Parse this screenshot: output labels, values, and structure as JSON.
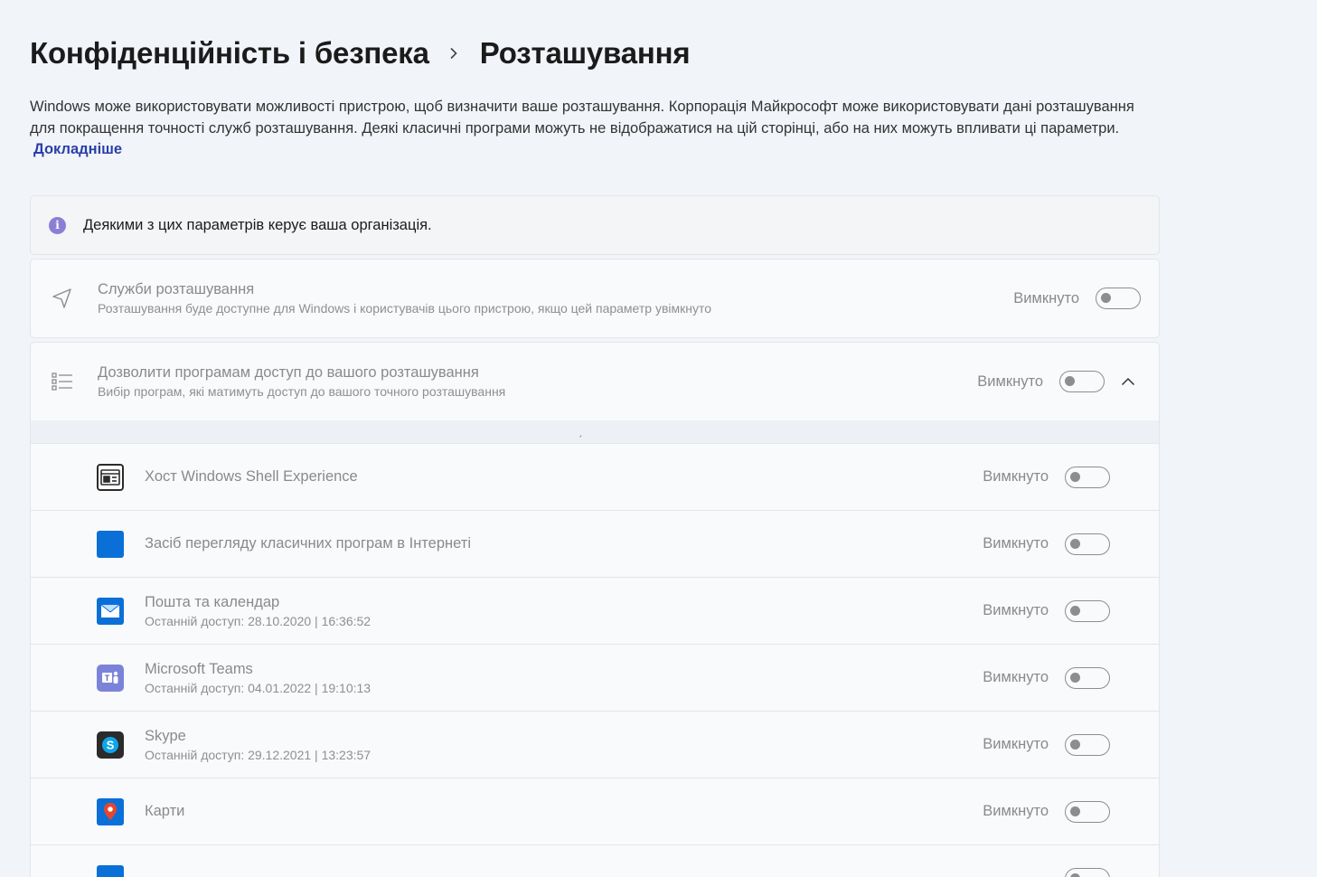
{
  "breadcrumb": {
    "parent": "Конфіденційність і безпека",
    "current": "Розташування"
  },
  "description": {
    "text": "Windows може використовувати можливості пристрою, щоб визначити ваше розташування. Корпорація Майкрософт може використовувати дані розташування для покращення точності служб розташування. Деякі класичні програми можуть не відображатися на цій сторінці, або на них можуть впливати ці параметри.",
    "link": "Докладніше"
  },
  "info_bar": {
    "icon": "info-icon",
    "text": "Деякими з цих параметрів керує ваша організація."
  },
  "location_services": {
    "icon": "location-arrow-icon",
    "title": "Служби розташування",
    "subtitle": "Розташування буде доступне для Windows і користувачів цього пристрою, якщо цей параметр увімкнуто",
    "state": "Вимкнуто"
  },
  "app_access": {
    "icon": "list-icon",
    "title": "Дозволити програмам доступ до вашого розташування",
    "subtitle": "Вибір програм, які матимуть доступ до вашого точного розташування",
    "state": "Вимкнуто"
  },
  "apps": [
    {
      "name": "Хост Windows Shell Experience",
      "sub": "",
      "state": "Вимкнуто",
      "icon": "shell-experience-icon",
      "color": "#2b2b2b"
    },
    {
      "name": "Засіб перегляду класичних програм в Інтернеті",
      "sub": "",
      "state": "Вимкнуто",
      "icon": "web-viewer-icon",
      "color": "#0b6fd8"
    },
    {
      "name": "Пошта та календар",
      "sub": "Останній доступ: 28.10.2020  |  16:36:52",
      "state": "Вимкнуто",
      "icon": "mail-icon",
      "color": "#0b6fd8"
    },
    {
      "name": "Microsoft Teams",
      "sub": "Останній доступ: 04.01.2022  |  19:10:13",
      "state": "Вимкнуто",
      "icon": "teams-icon",
      "color": "#7b83d9"
    },
    {
      "name": "Skype",
      "sub": "Останній доступ: 29.12.2021  |  13:23:57",
      "state": "Вимкнуто",
      "icon": "skype-icon",
      "color": "#2b2b2b"
    },
    {
      "name": "Карти",
      "sub": "",
      "state": "Вимкнуто",
      "icon": "maps-icon",
      "color": "#0b6fd8"
    },
    {
      "name": "",
      "sub": "",
      "state": "",
      "icon": "app-icon",
      "color": "#0b6fd8"
    }
  ]
}
